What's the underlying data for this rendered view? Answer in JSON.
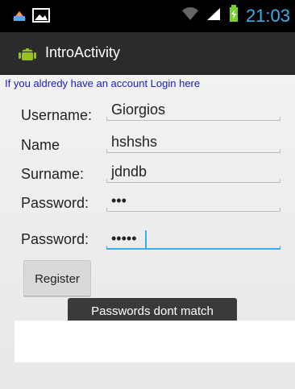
{
  "status_bar": {
    "time": "21:03",
    "icons": [
      "notification-icon",
      "image-icon",
      "wifi-icon",
      "signal-icon",
      "battery-icon"
    ]
  },
  "action_bar": {
    "title": "IntroActivity"
  },
  "login_link": "If you aldredy have an account Login here",
  "form": {
    "username": {
      "label": "Username:",
      "value": "Giorgios"
    },
    "name": {
      "label": "Name",
      "value": "hshshs"
    },
    "surname": {
      "label": "Surname:",
      "value": "jdndb"
    },
    "password": {
      "label": "Password:",
      "value": "•••"
    },
    "password_confirm": {
      "label": "Password:",
      "value": "•••••"
    }
  },
  "register_button": "Register",
  "toast": "Passwords dont match",
  "colors": {
    "accent": "#39aee8",
    "link": "#1a1ad1"
  }
}
